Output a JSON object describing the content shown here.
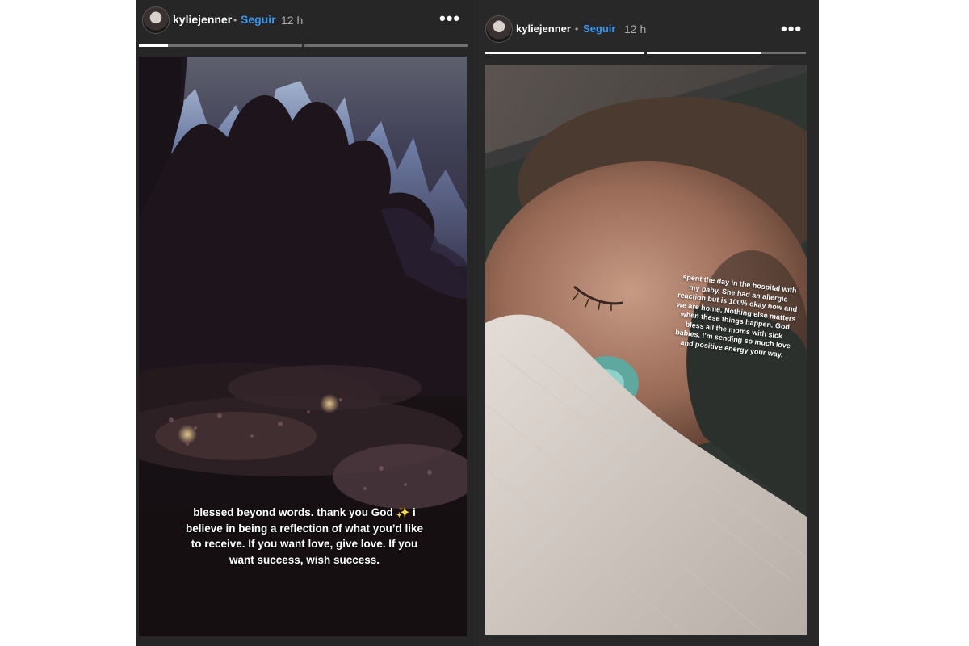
{
  "stories": [
    {
      "username": "kyliejenner",
      "separator": "•",
      "follow_label": "Seguir",
      "timestamp": "12 h",
      "more_label": "•••",
      "progress": [
        0.18,
        0.0
      ],
      "caption": "blessed beyond words. thank you God ✨ i believe in being a reflection of what you’d like to receive. If you want love, give love. If you want success, wish success."
    },
    {
      "username": "kyliejenner",
      "separator": "•",
      "follow_label": "Seguir",
      "timestamp": "12 h",
      "more_label": "•••",
      "progress": [
        1.0,
        0.72
      ],
      "caption": "spent the day in the hospital with my baby. She had an allergic reaction but is 100% okay now and we are home. Nothing else matters when these things happen. God bless all the moms with sick babies. I’m sending so much love and positive energy your way."
    }
  ]
}
